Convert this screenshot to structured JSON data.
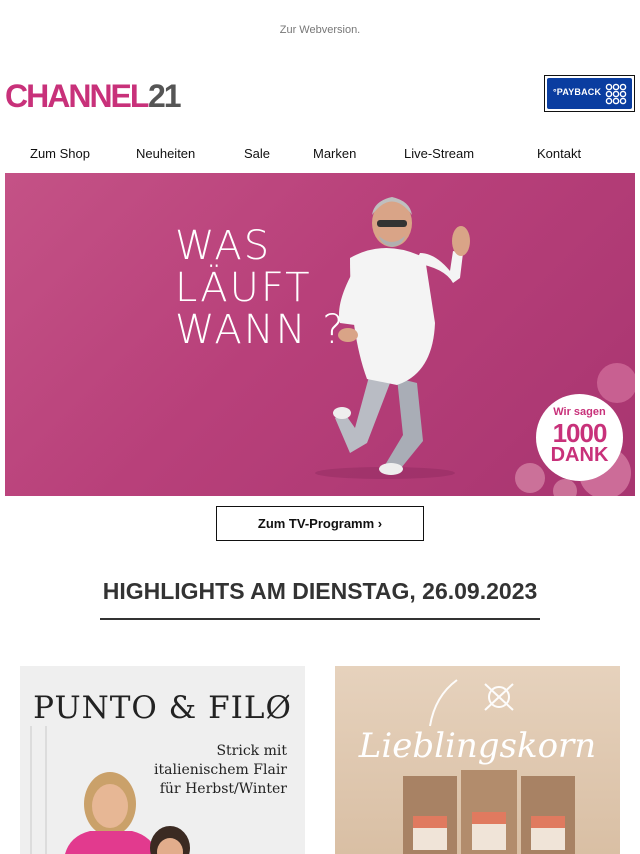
{
  "header": {
    "webversion_link": "Zur Webversion.",
    "logo_text": "CHANNEL21",
    "payback_text": "°PAYBACK"
  },
  "nav": {
    "items": [
      {
        "label": "Zum Shop"
      },
      {
        "label": "Neuheiten"
      },
      {
        "label": "Sale"
      },
      {
        "label": "Marken"
      },
      {
        "label": "Live-Stream"
      },
      {
        "label": "Kontakt"
      }
    ]
  },
  "hero": {
    "title_lines": [
      "WAS",
      "LÄUFT",
      "WANN ?"
    ],
    "badge_top": "Wir sagen",
    "badge_number": "1000",
    "badge_bottom": "DANK"
  },
  "tv_button_label": "Zum TV-Programm ›",
  "highlights_heading": "HIGHLIGHTS AM DIENSTAG, 26.09.2023",
  "products": [
    {
      "brand": "PUNTO & FILØ",
      "copy_lines": [
        "Strick mit",
        "italienischem Flair",
        "für Herbst/Winter"
      ]
    },
    {
      "brand": "Lieblingskorn"
    }
  ],
  "colors": {
    "brand_magenta": "#c8317a",
    "logo_grey": "#555555",
    "payback_blue": "#0a3da0",
    "hero_background": "#b8407a"
  }
}
